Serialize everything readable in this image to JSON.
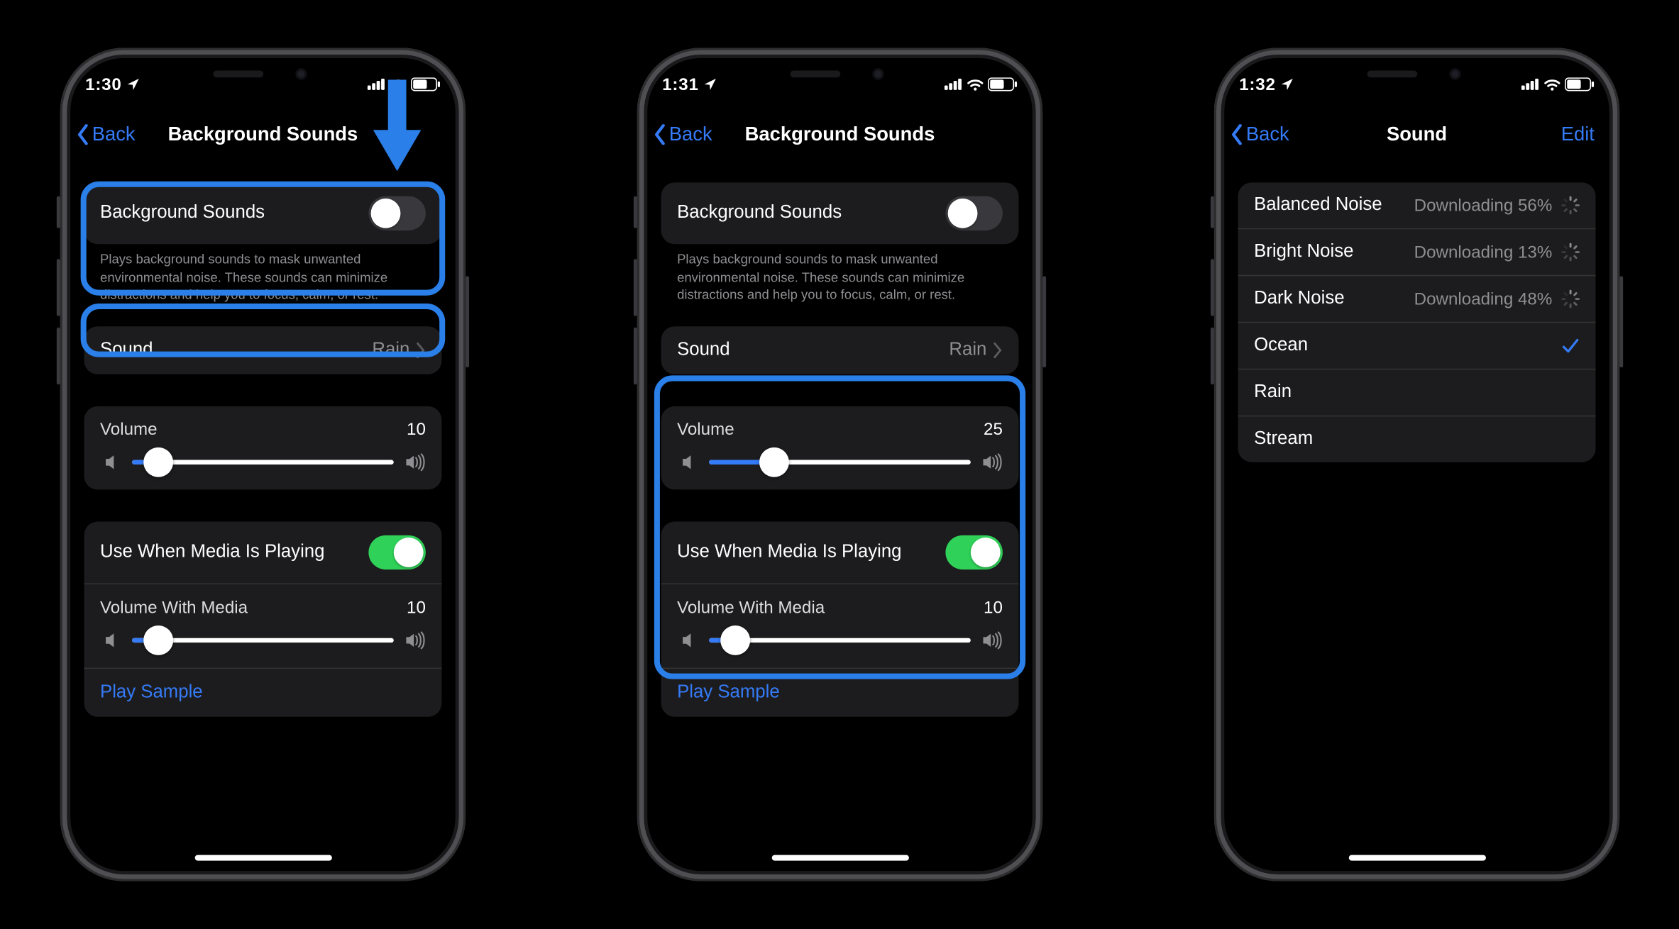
{
  "colors": {
    "accent": "#357bf7",
    "highlight": "#2a7fe8",
    "toggle_on": "#30d158"
  },
  "phone1": {
    "status": {
      "time": "1:30"
    },
    "nav": {
      "back": "Back",
      "title": "Background Sounds"
    },
    "toggle": {
      "label": "Background Sounds",
      "on": false
    },
    "desc": "Plays background sounds to mask unwanted environmental noise. These sounds can minimize distractions and help you to focus, calm, or rest.",
    "sound": {
      "label": "Sound",
      "value": "Rain"
    },
    "volume": {
      "label": "Volume",
      "value": "10",
      "percent": 10
    },
    "media_toggle": {
      "label": "Use When Media Is Playing",
      "on": true
    },
    "media_volume": {
      "label": "Volume With Media",
      "value": "10",
      "percent": 10
    },
    "play_sample": "Play Sample"
  },
  "phone2": {
    "status": {
      "time": "1:31"
    },
    "nav": {
      "back": "Back",
      "title": "Background Sounds"
    },
    "toggle": {
      "label": "Background Sounds",
      "on": false
    },
    "desc": "Plays background sounds to mask unwanted environmental noise. These sounds can minimize distractions and help you to focus, calm, or rest.",
    "sound": {
      "label": "Sound",
      "value": "Rain"
    },
    "volume": {
      "label": "Volume",
      "value": "25",
      "percent": 25
    },
    "media_toggle": {
      "label": "Use When Media Is Playing",
      "on": true
    },
    "media_volume": {
      "label": "Volume With Media",
      "value": "10",
      "percent": 10
    },
    "play_sample": "Play Sample"
  },
  "phone3": {
    "status": {
      "time": "1:32"
    },
    "nav": {
      "back": "Back",
      "title": "Sound",
      "edit": "Edit"
    },
    "list": [
      {
        "name": "Balanced Noise",
        "status": "Downloading 56%",
        "state": "downloading"
      },
      {
        "name": "Bright Noise",
        "status": "Downloading 13%",
        "state": "downloading"
      },
      {
        "name": "Dark Noise",
        "status": "Downloading 48%",
        "state": "downloading"
      },
      {
        "name": "Ocean",
        "state": "selected"
      },
      {
        "name": "Rain",
        "state": "none"
      },
      {
        "name": "Stream",
        "state": "none"
      }
    ]
  }
}
